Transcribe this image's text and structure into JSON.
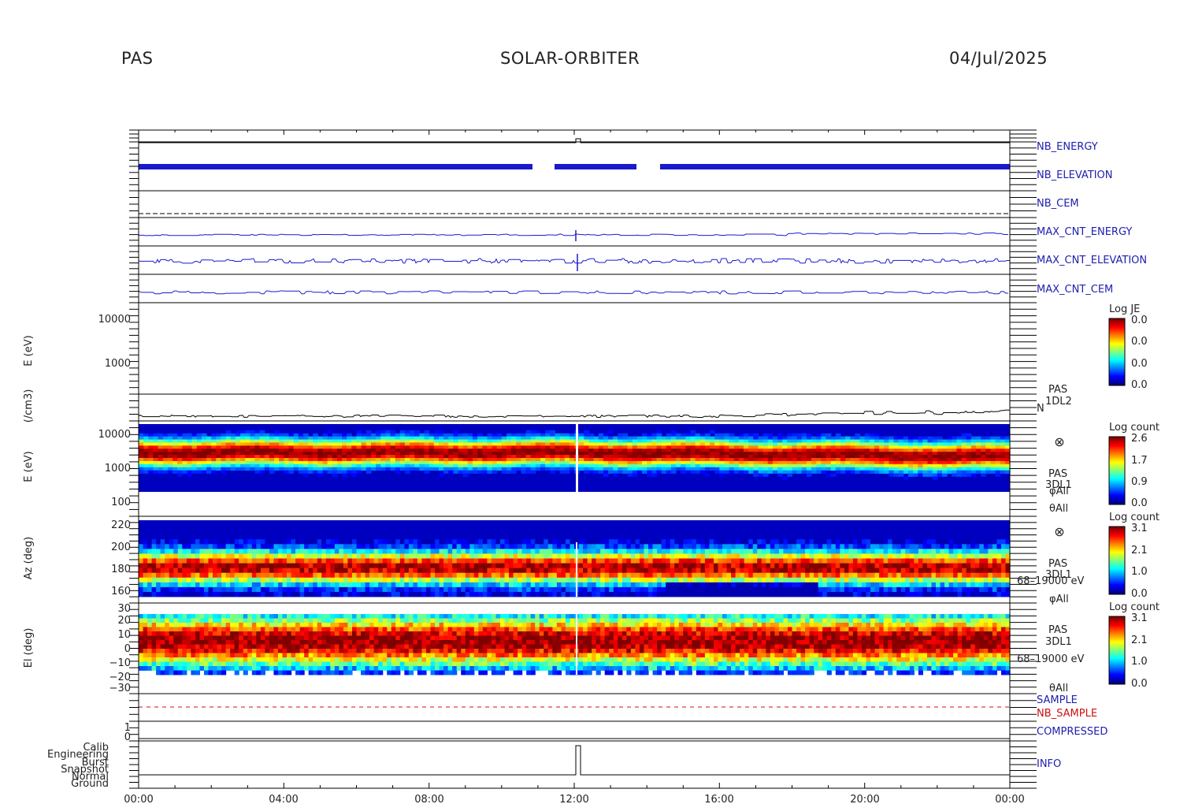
{
  "header": {
    "instrument": "PAS",
    "mission": "SOLAR-ORBITER",
    "date": "04/Jul/2025"
  },
  "time_axis": {
    "ticks": [
      "00:00",
      "04:00",
      "08:00",
      "12:00",
      "16:00",
      "20:00",
      "00:00"
    ]
  },
  "colors": {
    "trace_blue": "#1a1acc",
    "trace_black": "#000000",
    "label_blue": "#2020b0",
    "label_red": "#d01010",
    "spectro_fill": "#0000c0"
  },
  "panels": {
    "nb_energy": {
      "label": "NB_ENERGY"
    },
    "nb_elevation": {
      "label": "NB_ELEVATION"
    },
    "nb_cem": {
      "label": "NB_CEM"
    },
    "max_cnt_energy": {
      "label": "MAX_CNT_ENERGY"
    },
    "max_cnt_elevation": {
      "label": "MAX_CNT_ELEVATION"
    },
    "max_cnt_cem": {
      "label": "MAX_CNT_CEM"
    },
    "energy_empty": {
      "ylabel": "E (eV)",
      "ticks": [
        "10000",
        "1000"
      ],
      "colorbar": {
        "title": "Log JE",
        "ticks": [
          "0.0",
          "0.0",
          "0.0",
          "0.0"
        ]
      }
    },
    "density": {
      "ylabel": "(/cm3)",
      "side_label": [
        "PAS",
        "1DL2",
        "N"
      ]
    },
    "energy_spec": {
      "ylabel": "E (eV)",
      "ticks": [
        "10000",
        "1000",
        "100"
      ],
      "side_label": [
        "PAS",
        "3DL1",
        "φAll",
        "θAll"
      ],
      "symbol": "⊗",
      "colorbar": {
        "title": "Log count",
        "ticks": [
          "2.6",
          "1.7",
          "0.9",
          "0.0"
        ]
      }
    },
    "azimuth_spec": {
      "ylabel": "Az (deg)",
      "ticks": [
        "220",
        "200",
        "180",
        "160"
      ],
      "side_label": [
        "PAS",
        "3DL1",
        "68–19000 eV",
        "φAll"
      ],
      "symbol": "⊗",
      "colorbar": {
        "title": "Log count",
        "ticks": [
          "3.1",
          "2.1",
          "1.0",
          "0.0"
        ]
      }
    },
    "elevation_spec": {
      "ylabel": "El (deg)",
      "ticks": [
        "30",
        "20",
        "10",
        "0",
        "−10",
        "−20",
        "−30"
      ],
      "side_label": [
        "PAS",
        "3DL1",
        "68–19000 eV",
        "θAll"
      ],
      "colorbar": {
        "title": "Log count",
        "ticks": [
          "3.1",
          "2.1",
          "1.0",
          "0.0"
        ]
      }
    },
    "sample": {
      "label_sample": "SAMPLE",
      "label_nb_sample": "NB_SAMPLE"
    },
    "compressed": {
      "label": "COMPRESSED",
      "ticks": [
        "1",
        "0"
      ]
    },
    "info": {
      "label": "INFO",
      "ticks": [
        "Calib",
        "Engineering",
        "Burst",
        "Snapshot",
        "Normal",
        "Ground"
      ]
    }
  }
}
